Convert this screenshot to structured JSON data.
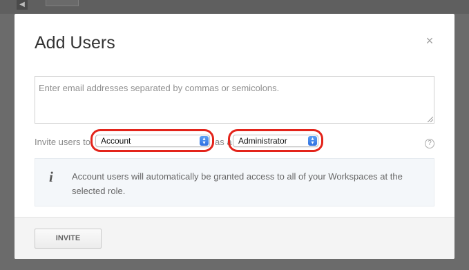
{
  "modal": {
    "title": "Add Users",
    "close_symbol": "×"
  },
  "emails": {
    "placeholder": "Enter email addresses separated by commas or semicolons.",
    "value": ""
  },
  "invite_row": {
    "prefix": "Invite users to",
    "account_select": {
      "selected": "Account"
    },
    "connector": "as a",
    "role_select": {
      "selected": "Administrator"
    },
    "help_symbol": "?"
  },
  "info": {
    "icon": "i",
    "text": "Account users will automatically be granted access to all of your Workspaces at the selected role."
  },
  "footer": {
    "invite_label": "INVITE"
  },
  "icons": {
    "close": "close-icon",
    "help": "question-circle-icon",
    "info": "info-icon",
    "back": "chevron-left-icon"
  },
  "colors": {
    "highlight": "#e3241b",
    "select_arrow": "#2f6fe0",
    "info_background": "#f4f7fa"
  }
}
